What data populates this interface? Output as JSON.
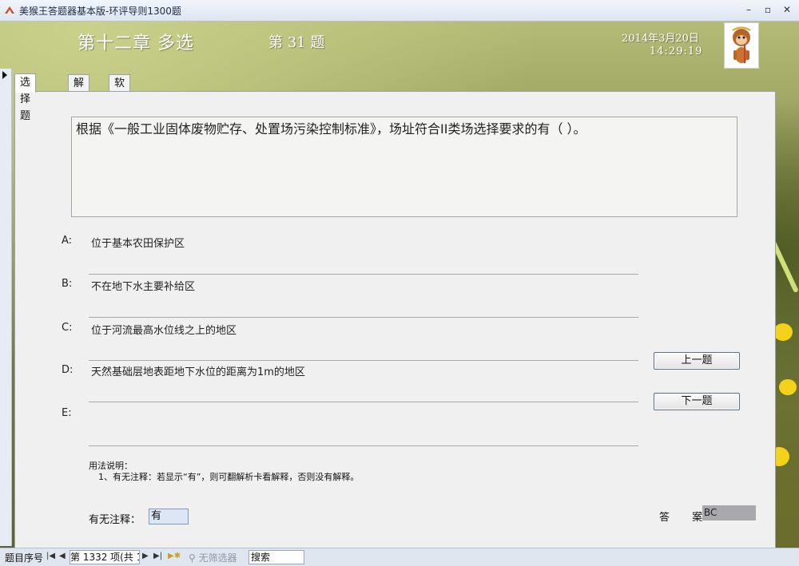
{
  "window": {
    "title": "美猴王答题器基本版-环评导则1300题",
    "minimize_glyph": "–",
    "maximize_glyph": "▫",
    "close_glyph": "✕"
  },
  "header": {
    "chapter": "第十二章  多选",
    "question_number": "第 31 题",
    "date": "2014年3月20日",
    "time": "14:29:19",
    "avatar_icon": "monkey-king-icon"
  },
  "tabs": [
    {
      "label": "选择题",
      "active": true
    },
    {
      "label": "解析",
      "active": false
    },
    {
      "label": "软件说明",
      "active": false
    }
  ],
  "question": {
    "text": "根据《一般工业固体废物贮存、处置场污染控制标准》，场址符合II类场选择要求的有（  ）。"
  },
  "options": [
    {
      "letter": "A:",
      "text": "位于基本农田保护区"
    },
    {
      "letter": "B:",
      "text": "不在地下水主要补给区"
    },
    {
      "letter": "C:",
      "text": "位于河流最高水位线之上的地区"
    },
    {
      "letter": "D:",
      "text": "天然基础层地表距地下水位的距离为1m的地区"
    },
    {
      "letter": "E:",
      "text": ""
    }
  ],
  "buttons": {
    "prev": "上一题",
    "next": "下一题"
  },
  "usage": {
    "title": "用法说明：",
    "line1": "1、有无注释：若显示“有”，则可翻解析卡看解释，否则没有解释。"
  },
  "annotation": {
    "label": "有无注释：",
    "value": "有"
  },
  "answer": {
    "label": "答 案",
    "colon": ":",
    "value": "BC"
  },
  "navbar": {
    "label": "题目序号",
    "record": "第 1332 项(共 1",
    "filter": "无筛选器",
    "search_placeholder": "搜索"
  }
}
